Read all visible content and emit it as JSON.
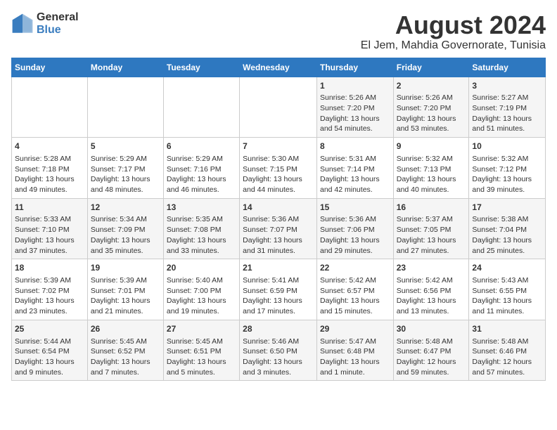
{
  "header": {
    "logo_general": "General",
    "logo_blue": "Blue",
    "month_title": "August 2024",
    "location": "El Jem, Mahdia Governorate, Tunisia"
  },
  "columns": [
    "Sunday",
    "Monday",
    "Tuesday",
    "Wednesday",
    "Thursday",
    "Friday",
    "Saturday"
  ],
  "weeks": [
    {
      "days": [
        {
          "num": "",
          "data": ""
        },
        {
          "num": "",
          "data": ""
        },
        {
          "num": "",
          "data": ""
        },
        {
          "num": "",
          "data": ""
        },
        {
          "num": "1",
          "data": "Sunrise: 5:26 AM\nSunset: 7:20 PM\nDaylight: 13 hours\nand 54 minutes."
        },
        {
          "num": "2",
          "data": "Sunrise: 5:26 AM\nSunset: 7:20 PM\nDaylight: 13 hours\nand 53 minutes."
        },
        {
          "num": "3",
          "data": "Sunrise: 5:27 AM\nSunset: 7:19 PM\nDaylight: 13 hours\nand 51 minutes."
        }
      ]
    },
    {
      "days": [
        {
          "num": "4",
          "data": "Sunrise: 5:28 AM\nSunset: 7:18 PM\nDaylight: 13 hours\nand 49 minutes."
        },
        {
          "num": "5",
          "data": "Sunrise: 5:29 AM\nSunset: 7:17 PM\nDaylight: 13 hours\nand 48 minutes."
        },
        {
          "num": "6",
          "data": "Sunrise: 5:29 AM\nSunset: 7:16 PM\nDaylight: 13 hours\nand 46 minutes."
        },
        {
          "num": "7",
          "data": "Sunrise: 5:30 AM\nSunset: 7:15 PM\nDaylight: 13 hours\nand 44 minutes."
        },
        {
          "num": "8",
          "data": "Sunrise: 5:31 AM\nSunset: 7:14 PM\nDaylight: 13 hours\nand 42 minutes."
        },
        {
          "num": "9",
          "data": "Sunrise: 5:32 AM\nSunset: 7:13 PM\nDaylight: 13 hours\nand 40 minutes."
        },
        {
          "num": "10",
          "data": "Sunrise: 5:32 AM\nSunset: 7:12 PM\nDaylight: 13 hours\nand 39 minutes."
        }
      ]
    },
    {
      "days": [
        {
          "num": "11",
          "data": "Sunrise: 5:33 AM\nSunset: 7:10 PM\nDaylight: 13 hours\nand 37 minutes."
        },
        {
          "num": "12",
          "data": "Sunrise: 5:34 AM\nSunset: 7:09 PM\nDaylight: 13 hours\nand 35 minutes."
        },
        {
          "num": "13",
          "data": "Sunrise: 5:35 AM\nSunset: 7:08 PM\nDaylight: 13 hours\nand 33 minutes."
        },
        {
          "num": "14",
          "data": "Sunrise: 5:36 AM\nSunset: 7:07 PM\nDaylight: 13 hours\nand 31 minutes."
        },
        {
          "num": "15",
          "data": "Sunrise: 5:36 AM\nSunset: 7:06 PM\nDaylight: 13 hours\nand 29 minutes."
        },
        {
          "num": "16",
          "data": "Sunrise: 5:37 AM\nSunset: 7:05 PM\nDaylight: 13 hours\nand 27 minutes."
        },
        {
          "num": "17",
          "data": "Sunrise: 5:38 AM\nSunset: 7:04 PM\nDaylight: 13 hours\nand 25 minutes."
        }
      ]
    },
    {
      "days": [
        {
          "num": "18",
          "data": "Sunrise: 5:39 AM\nSunset: 7:02 PM\nDaylight: 13 hours\nand 23 minutes."
        },
        {
          "num": "19",
          "data": "Sunrise: 5:39 AM\nSunset: 7:01 PM\nDaylight: 13 hours\nand 21 minutes."
        },
        {
          "num": "20",
          "data": "Sunrise: 5:40 AM\nSunset: 7:00 PM\nDaylight: 13 hours\nand 19 minutes."
        },
        {
          "num": "21",
          "data": "Sunrise: 5:41 AM\nSunset: 6:59 PM\nDaylight: 13 hours\nand 17 minutes."
        },
        {
          "num": "22",
          "data": "Sunrise: 5:42 AM\nSunset: 6:57 PM\nDaylight: 13 hours\nand 15 minutes."
        },
        {
          "num": "23",
          "data": "Sunrise: 5:42 AM\nSunset: 6:56 PM\nDaylight: 13 hours\nand 13 minutes."
        },
        {
          "num": "24",
          "data": "Sunrise: 5:43 AM\nSunset: 6:55 PM\nDaylight: 13 hours\nand 11 minutes."
        }
      ]
    },
    {
      "days": [
        {
          "num": "25",
          "data": "Sunrise: 5:44 AM\nSunset: 6:54 PM\nDaylight: 13 hours\nand 9 minutes."
        },
        {
          "num": "26",
          "data": "Sunrise: 5:45 AM\nSunset: 6:52 PM\nDaylight: 13 hours\nand 7 minutes."
        },
        {
          "num": "27",
          "data": "Sunrise: 5:45 AM\nSunset: 6:51 PM\nDaylight: 13 hours\nand 5 minutes."
        },
        {
          "num": "28",
          "data": "Sunrise: 5:46 AM\nSunset: 6:50 PM\nDaylight: 13 hours\nand 3 minutes."
        },
        {
          "num": "29",
          "data": "Sunrise: 5:47 AM\nSunset: 6:48 PM\nDaylight: 13 hours\nand 1 minute."
        },
        {
          "num": "30",
          "data": "Sunrise: 5:48 AM\nSunset: 6:47 PM\nDaylight: 12 hours\nand 59 minutes."
        },
        {
          "num": "31",
          "data": "Sunrise: 5:48 AM\nSunset: 6:46 PM\nDaylight: 12 hours\nand 57 minutes."
        }
      ]
    }
  ]
}
